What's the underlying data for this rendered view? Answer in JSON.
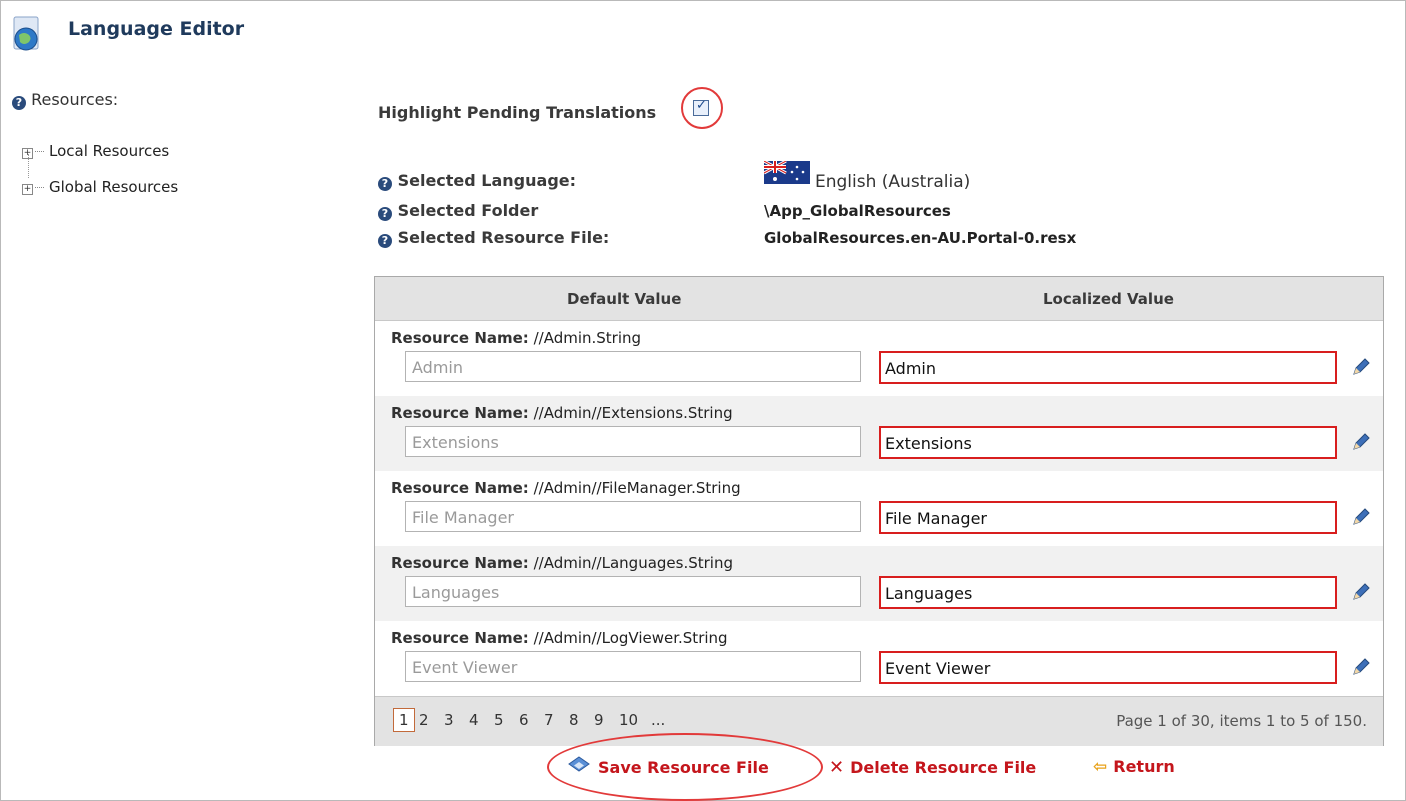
{
  "header": {
    "title": "Language Editor",
    "icon": "language-editor-icon"
  },
  "sidebar": {
    "resources_label": "Resources:",
    "items": [
      {
        "label": "Local Resources"
      },
      {
        "label": "Global Resources"
      }
    ]
  },
  "options": {
    "highlight_label": "Highlight Pending Translations",
    "highlight_checked": true
  },
  "selection": {
    "language_label": "Selected Language:",
    "language_value": "English (Australia)",
    "folder_label": "Selected Folder",
    "folder_value": "\\App_GlobalResources",
    "file_label": "Selected Resource File:",
    "file_value": "GlobalResources.en-AU.Portal-0.resx"
  },
  "grid": {
    "columns": [
      "Default Value",
      "Localized Value"
    ],
    "rows": [
      {
        "name_label": "Resource Name:",
        "name": "//Admin.String",
        "default_value": "Admin",
        "localized_value": "Admin"
      },
      {
        "name_label": "Resource Name:",
        "name": "//Admin//Extensions.String",
        "default_value": "Extensions",
        "localized_value": "Extensions"
      },
      {
        "name_label": "Resource Name:",
        "name": "//Admin//FileManager.String",
        "default_value": "File Manager",
        "localized_value": "File Manager"
      },
      {
        "name_label": "Resource Name:",
        "name": "//Admin//Languages.String",
        "default_value": "Languages",
        "localized_value": "Languages"
      },
      {
        "name_label": "Resource Name:",
        "name": "//Admin//LogViewer.String",
        "default_value": "Event Viewer",
        "localized_value": "Event Viewer"
      }
    ],
    "pager": {
      "pages": [
        "1",
        "2",
        "3",
        "4",
        "5",
        "6",
        "7",
        "8",
        "9",
        "10",
        "..."
      ],
      "current": "1",
      "info": "Page 1 of 30, items 1 to 5 of 150."
    }
  },
  "actions": {
    "save": "Save Resource File",
    "delete": "Delete Resource File",
    "return": "Return"
  },
  "colors": {
    "accent_red": "#d81e1e",
    "title_blue": "#1f3a5c",
    "action_red": "#c4161c"
  }
}
